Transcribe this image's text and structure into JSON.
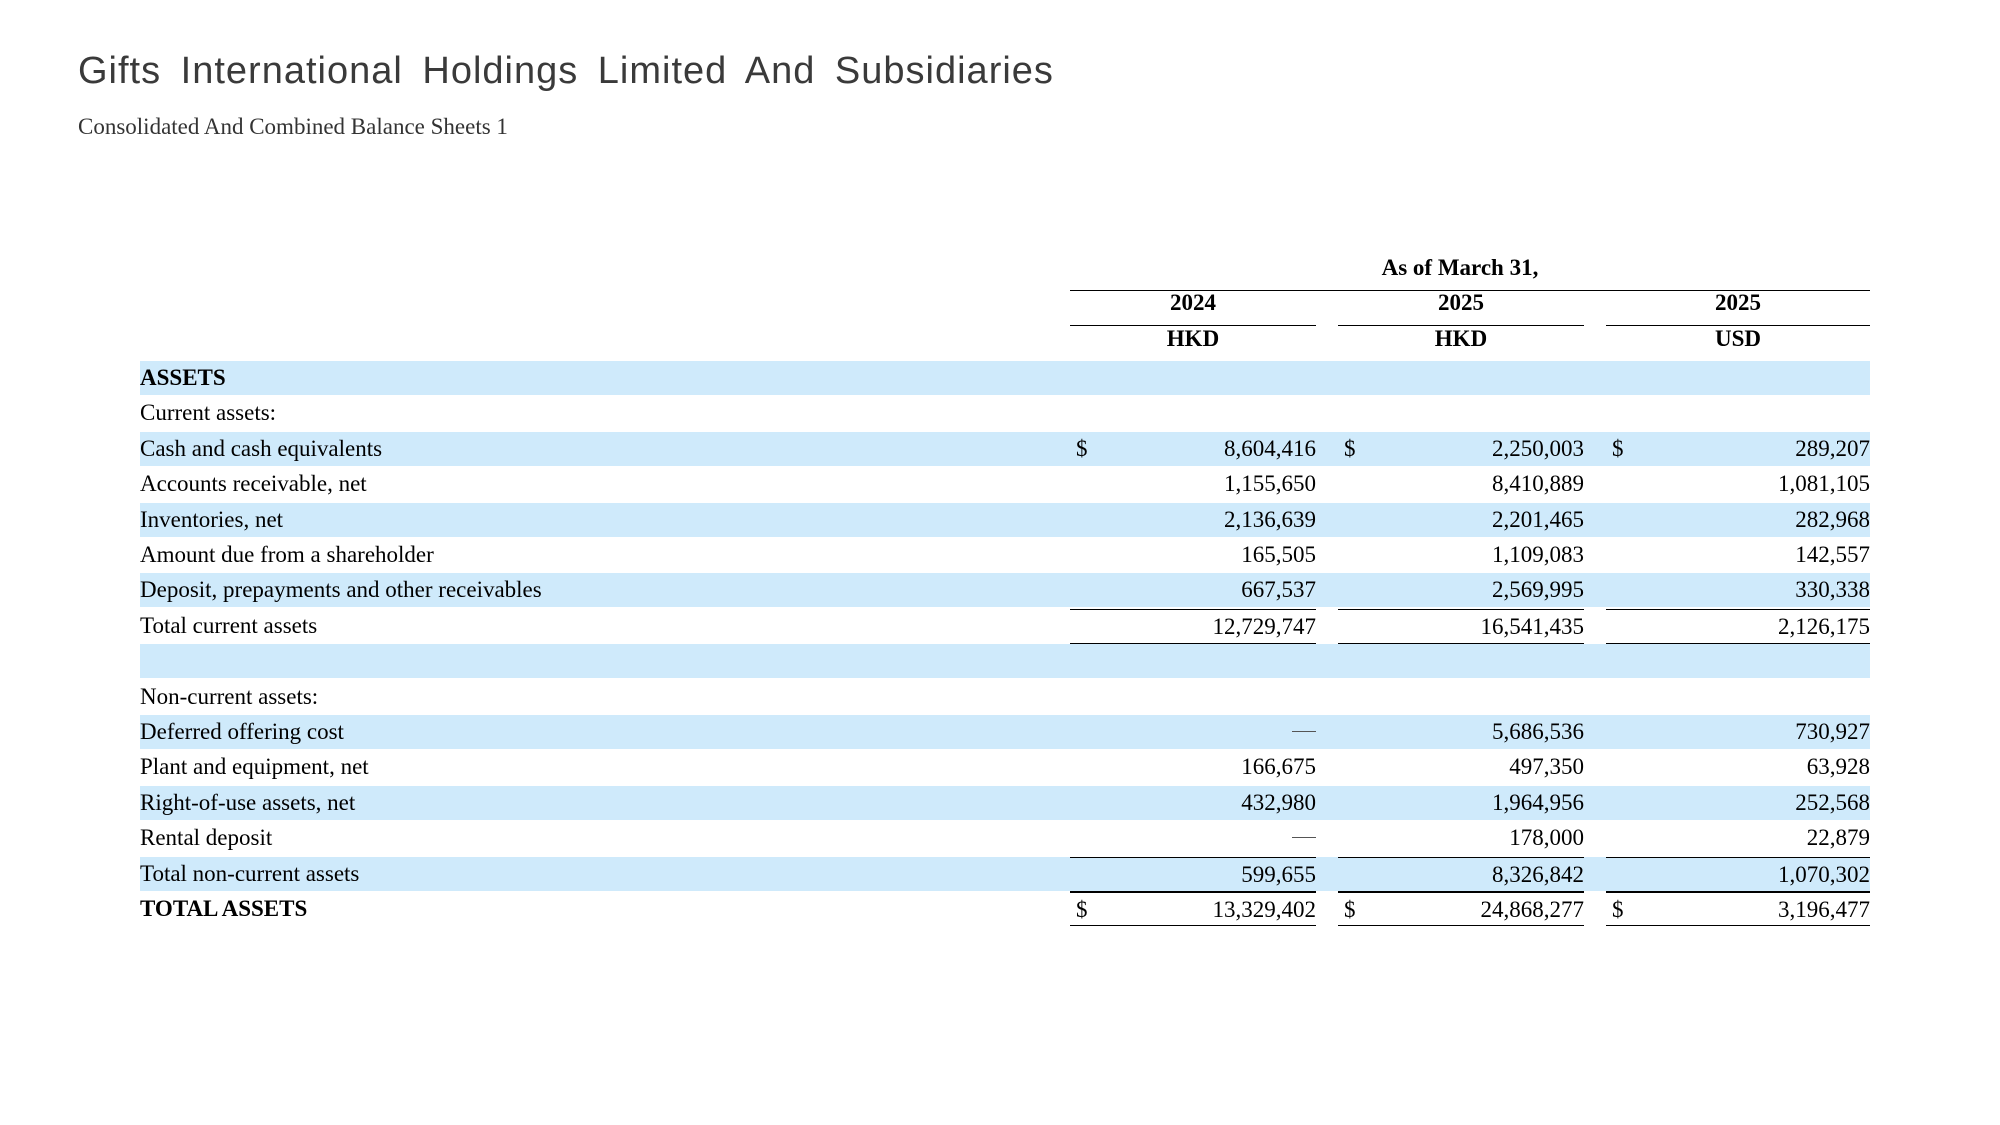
{
  "document": {
    "title": "Gifts International Holdings Limited And Subsidiaries",
    "subtitle": "Consolidated And Combined Balance Sheets 1"
  },
  "table": {
    "group_header": "As of March 31,",
    "columns": [
      {
        "year": "2024",
        "currency": "HKD"
      },
      {
        "year": "2025",
        "currency": "HKD"
      },
      {
        "year": "2025",
        "currency": "USD"
      }
    ],
    "currency_symbol": "$",
    "rows": [
      {
        "label": "ASSETS",
        "bold": true,
        "shaded": true,
        "values": [
          null,
          null,
          null
        ]
      },
      {
        "label": "Current assets:",
        "shaded": false,
        "values": [
          null,
          null,
          null
        ]
      },
      {
        "label": "Cash and cash equivalents",
        "shaded": true,
        "dollar": true,
        "values": [
          "8,604,416",
          "2,250,003",
          "289,207"
        ]
      },
      {
        "label": "Accounts receivable, net",
        "shaded": false,
        "values": [
          "1,155,650",
          "8,410,889",
          "1,081,105"
        ]
      },
      {
        "label": "Inventories, net",
        "shaded": true,
        "values": [
          "2,136,639",
          "2,201,465",
          "282,968"
        ]
      },
      {
        "label": "Amount due from a shareholder",
        "shaded": false,
        "values": [
          "165,505",
          "1,109,083",
          "142,557"
        ]
      },
      {
        "label": "Deposit, prepayments and other receivables",
        "shaded": true,
        "values": [
          "667,537",
          "2,569,995",
          "330,338"
        ]
      },
      {
        "label": "Total current assets",
        "shaded": false,
        "total": true,
        "values": [
          "12,729,747",
          "16,541,435",
          "2,126,175"
        ]
      },
      {
        "label": "",
        "shaded": true,
        "values": [
          null,
          null,
          null
        ]
      },
      {
        "label": "Non-current assets:",
        "shaded": false,
        "values": [
          null,
          null,
          null
        ]
      },
      {
        "label": "Deferred offering cost",
        "shaded": true,
        "values": [
          "—",
          "5,686,536",
          "730,927"
        ]
      },
      {
        "label": "Plant and equipment, net",
        "shaded": false,
        "values": [
          "166,675",
          "497,350",
          "63,928"
        ]
      },
      {
        "label": "Right-of-use assets, net",
        "shaded": true,
        "values": [
          "432,980",
          "1,964,956",
          "252,568"
        ]
      },
      {
        "label": "Rental deposit",
        "shaded": false,
        "values": [
          "—",
          "178,000",
          "22,879"
        ]
      },
      {
        "label": "Total non-current assets",
        "shaded": true,
        "total": true,
        "values": [
          "599,655",
          "8,326,842",
          "1,070,302"
        ]
      },
      {
        "label": "TOTAL ASSETS",
        "bold": true,
        "shaded": false,
        "dollar": true,
        "grand": true,
        "values": [
          "13,329,402",
          "24,868,277",
          "3,196,477"
        ]
      }
    ]
  }
}
